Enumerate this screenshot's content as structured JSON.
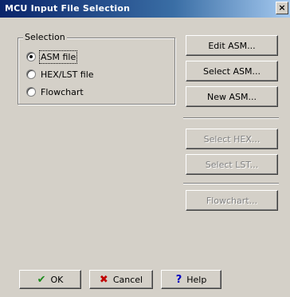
{
  "window": {
    "title": "MCU Input File Selection",
    "close_label": "×"
  },
  "selection": {
    "legend": "Selection",
    "options": [
      {
        "label": "ASM file",
        "checked": true
      },
      {
        "label": "HEX/LST file",
        "checked": false
      },
      {
        "label": "Flowchart",
        "checked": false
      }
    ]
  },
  "right_buttons": {
    "edit_asm": "Edit ASM...",
    "select_asm": "Select ASM...",
    "new_asm": "New ASM...",
    "select_hex": "Select HEX...",
    "select_lst": "Select LST...",
    "flowchart": "Flowchart..."
  },
  "bottom_buttons": {
    "ok": "OK",
    "cancel": "Cancel",
    "help": "Help"
  },
  "icons": {
    "ok": "checkmark-icon",
    "cancel": "x-icon",
    "help": "question-mark-icon"
  }
}
